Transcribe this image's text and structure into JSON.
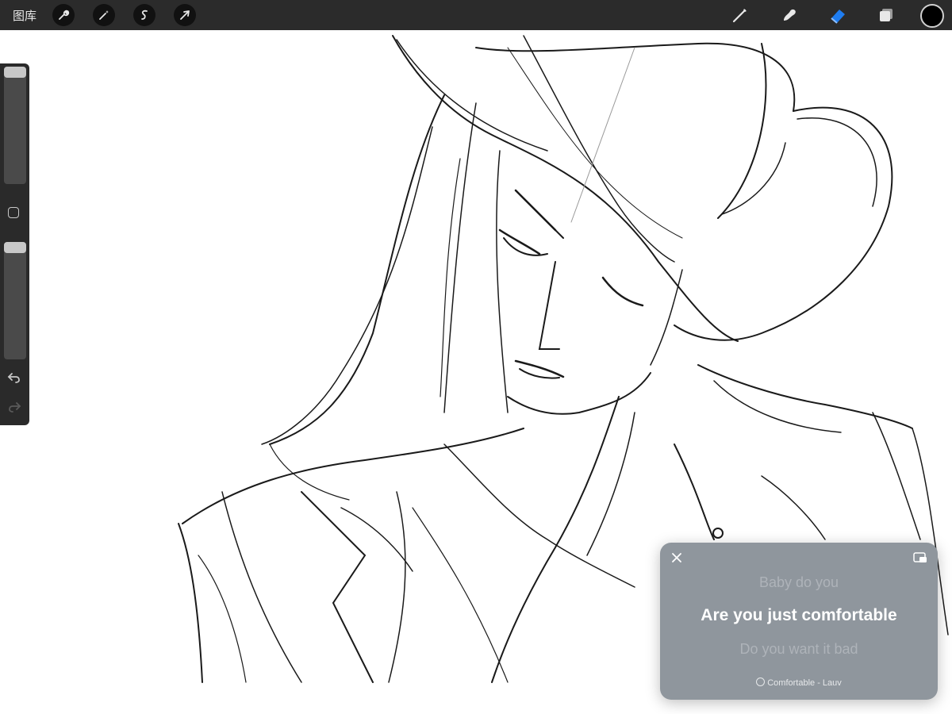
{
  "toolbar": {
    "gallery_label": "图库",
    "left_tools": [
      {
        "icon": "wrench-icon",
        "name": "actions"
      },
      {
        "icon": "magic-wand-icon",
        "name": "adjustments"
      },
      {
        "icon": "selection-s-icon",
        "name": "selection"
      },
      {
        "icon": "arrow-cursor-icon",
        "name": "transform"
      }
    ],
    "right_tools": [
      {
        "icon": "brush-icon",
        "name": "paint"
      },
      {
        "icon": "smudge-icon",
        "name": "smudge"
      },
      {
        "icon": "eraser-icon",
        "name": "erase",
        "active": true
      },
      {
        "icon": "layers-icon",
        "name": "layers"
      }
    ],
    "active_color": "#000000",
    "accent_color": "#1f7df0"
  },
  "sidebar": {
    "brush_size_level": 0.0,
    "opacity_level": 0.0,
    "modify_icon": "square-icon",
    "undo_icon": "undo-icon",
    "redo_icon": "redo-icon"
  },
  "lyrics_widget": {
    "previous_line": "Baby do you",
    "current_line": "Are you just comfortable",
    "next_line": "Do you want it bad",
    "now_playing": "Comfortable - Lauv",
    "close_icon": "close-icon",
    "pip_icon": "picture-in-picture-icon"
  }
}
